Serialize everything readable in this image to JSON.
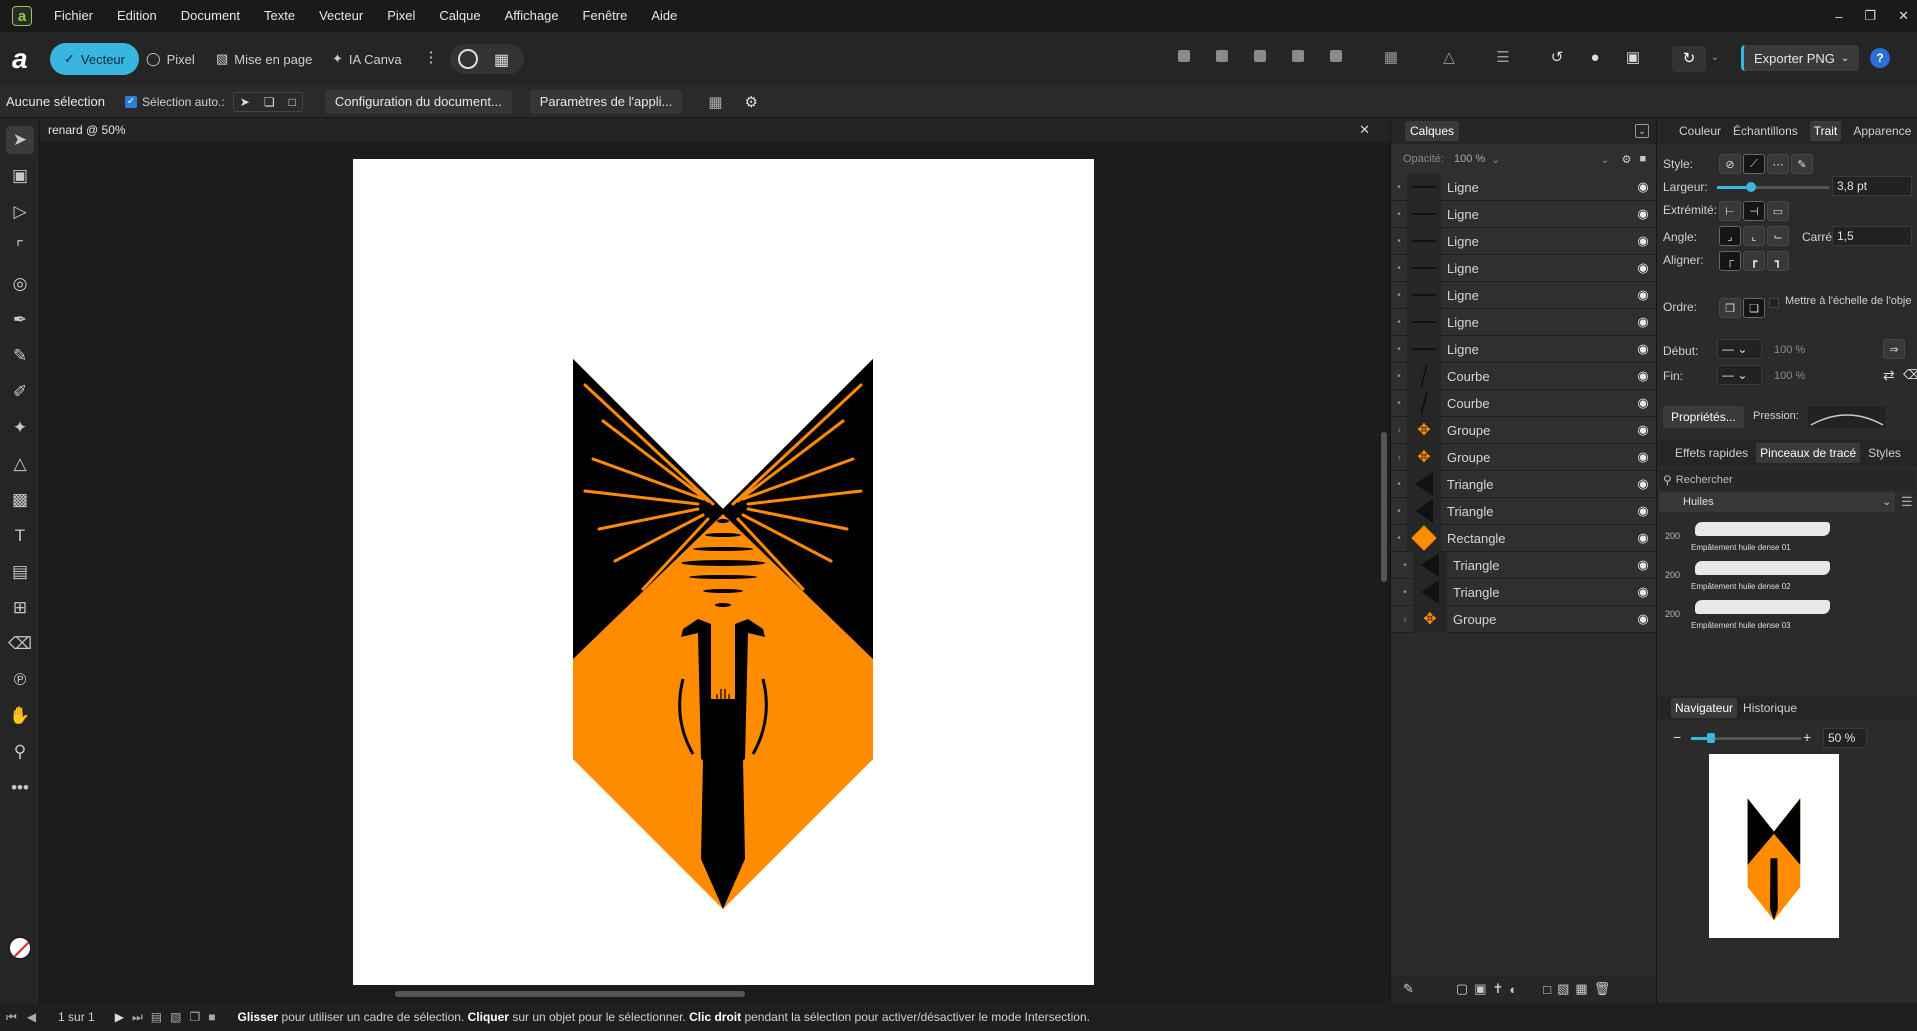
{
  "app": {
    "menu": [
      "Fichier",
      "Edition",
      "Document",
      "Texte",
      "Vecteur",
      "Pixel",
      "Calque",
      "Affichage",
      "Fenêtre",
      "Aide"
    ],
    "logo_letter": "a"
  },
  "toolbar": {
    "personas": [
      {
        "label": "Vecteur",
        "icon": "pen-nib-icon",
        "active": true
      },
      {
        "label": "Pixel",
        "icon": "pixel-circle-icon",
        "active": false
      },
      {
        "label": "Mise en page",
        "icon": "layout-icon",
        "active": false
      },
      {
        "label": "IA Canva",
        "icon": "sparkle-icon",
        "active": false
      }
    ],
    "export_label": "Exporter PNG"
  },
  "context": {
    "selection_status": "Aucune sélection",
    "auto_select_label": "Sélection auto.:",
    "doc_config_label": "Configuration du document...",
    "app_params_label": "Paramètres de l'appli..."
  },
  "document": {
    "tab_title": "renard @ 50%",
    "colors": {
      "orange": "#ff8c00",
      "black": "#000000"
    }
  },
  "layers": {
    "title": "Calques",
    "opacity_label": "Opacité:",
    "opacity_value": "100 %",
    "items": [
      {
        "name": "Ligne",
        "indent": 0
      },
      {
        "name": "Ligne",
        "indent": 0
      },
      {
        "name": "Ligne",
        "indent": 0
      },
      {
        "name": "Ligne",
        "indent": 0
      },
      {
        "name": "Ligne",
        "indent": 0
      },
      {
        "name": "Ligne",
        "indent": 0
      },
      {
        "name": "Ligne",
        "indent": 0
      },
      {
        "name": "Courbe",
        "indent": 0
      },
      {
        "name": "Courbe",
        "indent": 0
      },
      {
        "name": "Groupe",
        "indent": 0
      },
      {
        "name": "Groupe",
        "indent": 0
      },
      {
        "name": "Triangle",
        "indent": 0
      },
      {
        "name": "Triangle",
        "indent": 0
      },
      {
        "name": "Rectangle",
        "indent": 0
      },
      {
        "name": "Triangle",
        "indent": 1
      },
      {
        "name": "Triangle",
        "indent": 1
      },
      {
        "name": "Groupe",
        "indent": 1
      }
    ]
  },
  "stroke_panel": {
    "tabs": [
      "Couleur",
      "Échantillons",
      "Trait",
      "Apparence"
    ],
    "active_tab": "Trait",
    "style_label": "Style:",
    "width_label": "Largeur:",
    "width_value": "3,8 pt",
    "width_fraction": 0.3,
    "cap_label": "Extrémité:",
    "join_label": "Angle:",
    "miter_label": "Carré:",
    "miter_value": "1,5",
    "align_label": "Aligner:",
    "order_label": "Ordre:",
    "scale_label": "Mettre à l'échelle de l'obje",
    "start_label": "Début:",
    "end_label": "Fin:",
    "start_pct": "100 %",
    "end_pct": "100 %",
    "properties_label": "Propriétés...",
    "pressure_label": "Pression:"
  },
  "brushes_panel": {
    "tabs": [
      "Effets rapides",
      "Pinceaux de tracé",
      "Styles"
    ],
    "active_tab": "Pinceaux de tracé",
    "search_placeholder": "Rechercher",
    "category": "Huiles",
    "brushes": [
      {
        "size": "200",
        "name": "Empâtement huile dense 01"
      },
      {
        "size": "200",
        "name": "Empâtement huile dense 02"
      },
      {
        "size": "200",
        "name": "Empâtement huile dense 03"
      }
    ]
  },
  "navigator": {
    "tabs": [
      "Navigateur",
      "Historique"
    ],
    "active_tab": "Navigateur",
    "zoom_value": "50 %",
    "zoom_fraction": 0.18
  },
  "status": {
    "page_info": "1 sur 1",
    "hint_parts": [
      {
        "text": "Glisser",
        "bold": true
      },
      {
        "text": " pour utiliser un cadre de sélection. ",
        "bold": false
      },
      {
        "text": "Cliquer",
        "bold": true
      },
      {
        "text": " sur un objet pour le sélectionner. ",
        "bold": false
      },
      {
        "text": "Clic droit",
        "bold": true
      },
      {
        "text": " pendant la sélection pour activer/désactiver le mode Intersection.",
        "bold": false
      }
    ]
  }
}
